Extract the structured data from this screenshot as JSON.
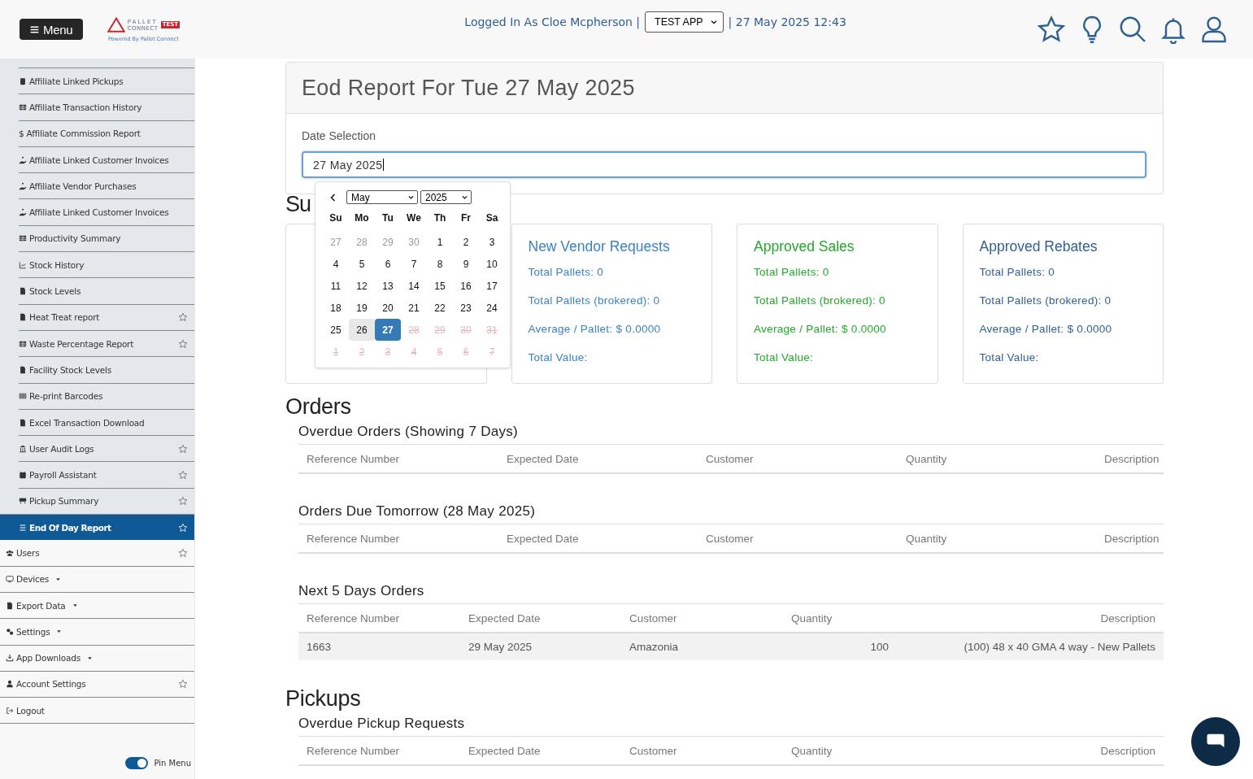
{
  "header": {
    "menu_button": "Menu",
    "logo": {
      "top": "PALLET",
      "middle": "CONNECT",
      "badge": "TEST",
      "caption": "Powered By Pallet Connect"
    },
    "logged_in": "Logged In As Cloe Mcpherson |",
    "app_select": "TEST APP",
    "datetime": "| 27 May 2025 12:43"
  },
  "sidebar": {
    "items": [
      {
        "label": "Affiliate Linked Pickups",
        "kind": "subitem",
        "selected": false,
        "favorite_button": false,
        "expandable": false
      },
      {
        "label": "Affiliate Transaction History",
        "kind": "subitem",
        "selected": false,
        "favorite_button": false,
        "expandable": false
      },
      {
        "label": "$ Affiliate Commission Report",
        "kind": "subitem",
        "selected": false,
        "favorite_button": false,
        "expandable": false
      },
      {
        "label": "Affiliate Linked Customer Invoices",
        "kind": "subitem",
        "selected": false,
        "favorite_button": false,
        "expandable": false
      },
      {
        "label": "Affiliate Vendor Purchases",
        "kind": "subitem",
        "selected": false,
        "favorite_button": false,
        "expandable": false
      },
      {
        "label": "Affiliate Linked Customer Invoices",
        "kind": "subitem",
        "selected": false,
        "favorite_button": false,
        "expandable": false
      },
      {
        "label": "Productivity Summary",
        "kind": "subitem",
        "selected": false,
        "favorite_button": false,
        "expandable": false
      },
      {
        "label": "Stock History",
        "kind": "subitem",
        "selected": false,
        "favorite_button": false,
        "expandable": false
      },
      {
        "label": "Stock Levels",
        "kind": "subitem",
        "selected": false,
        "favorite_button": false,
        "expandable": false
      },
      {
        "label": "Heat Treat report",
        "kind": "subitem",
        "selected": false,
        "favorite_button": true,
        "expandable": false
      },
      {
        "label": "Waste Percentage Report",
        "kind": "subitem",
        "selected": false,
        "favorite_button": true,
        "expandable": false
      },
      {
        "label": "Facility Stock Levels",
        "kind": "subitem",
        "selected": false,
        "favorite_button": false,
        "expandable": false
      },
      {
        "label": "Re-print Barcodes",
        "kind": "subitem",
        "selected": false,
        "favorite_button": false,
        "expandable": false
      },
      {
        "label": "Excel Transaction Download",
        "kind": "subitem",
        "selected": false,
        "favorite_button": false,
        "expandable": false
      },
      {
        "label": "User Audit Logs",
        "kind": "subitem",
        "selected": false,
        "favorite_button": true,
        "expandable": false
      },
      {
        "label": "Payroll Assistant",
        "kind": "subitem",
        "selected": false,
        "favorite_button": true,
        "expandable": false
      },
      {
        "label": "Pickup Summary",
        "kind": "subitem",
        "selected": false,
        "favorite_button": true,
        "expandable": false
      },
      {
        "label": "End Of Day Report",
        "kind": "subitem",
        "selected": true,
        "favorite_button": true,
        "expandable": false
      },
      {
        "label": "Users",
        "kind": "item",
        "selected": false,
        "favorite_button": true,
        "expandable": false
      },
      {
        "label": "Devices",
        "kind": "item",
        "selected": false,
        "favorite_button": false,
        "expandable": true
      },
      {
        "label": "Export Data",
        "kind": "item",
        "selected": false,
        "favorite_button": false,
        "expandable": true
      },
      {
        "label": "Settings",
        "kind": "item",
        "selected": false,
        "favorite_button": false,
        "expandable": true
      },
      {
        "label": "App Downloads",
        "kind": "item",
        "selected": false,
        "favorite_button": false,
        "expandable": true
      },
      {
        "label": "Account Settings",
        "kind": "item",
        "selected": false,
        "favorite_button": true,
        "expandable": false
      },
      {
        "label": "Logout",
        "kind": "item",
        "selected": false,
        "favorite_button": false,
        "expandable": false
      }
    ],
    "pin_menu": {
      "label": "Pin Menu",
      "on": true
    }
  },
  "report": {
    "title": "Eod Report For Tue 27 May 2025",
    "date_label": "Date Selection",
    "date_value": "27 May 2025"
  },
  "calendar": {
    "month": "May",
    "year": "2025",
    "weekdays": [
      "Su",
      "Mo",
      "Tu",
      "We",
      "Th",
      "Fr",
      "Sa"
    ],
    "days": [
      {
        "label": "27",
        "kind": "outside",
        "selected": false,
        "hovered": false
      },
      {
        "label": "28",
        "kind": "outside",
        "selected": false,
        "hovered": false
      },
      {
        "label": "29",
        "kind": "outside",
        "selected": false,
        "hovered": false
      },
      {
        "label": "30",
        "kind": "outside",
        "selected": false,
        "hovered": false
      },
      {
        "label": "1",
        "kind": "day",
        "selected": false,
        "hovered": false
      },
      {
        "label": "2",
        "kind": "day",
        "selected": false,
        "hovered": false
      },
      {
        "label": "3",
        "kind": "day",
        "selected": false,
        "hovered": false
      },
      {
        "label": "4",
        "kind": "day",
        "selected": false,
        "hovered": false
      },
      {
        "label": "5",
        "kind": "day",
        "selected": false,
        "hovered": false
      },
      {
        "label": "6",
        "kind": "day",
        "selected": false,
        "hovered": false
      },
      {
        "label": "7",
        "kind": "day",
        "selected": false,
        "hovered": false
      },
      {
        "label": "8",
        "kind": "day",
        "selected": false,
        "hovered": false
      },
      {
        "label": "9",
        "kind": "day",
        "selected": false,
        "hovered": false
      },
      {
        "label": "10",
        "kind": "day",
        "selected": false,
        "hovered": false
      },
      {
        "label": "11",
        "kind": "day",
        "selected": false,
        "hovered": false
      },
      {
        "label": "12",
        "kind": "day",
        "selected": false,
        "hovered": false
      },
      {
        "label": "13",
        "kind": "day",
        "selected": false,
        "hovered": false
      },
      {
        "label": "14",
        "kind": "day",
        "selected": false,
        "hovered": false
      },
      {
        "label": "15",
        "kind": "day",
        "selected": false,
        "hovered": false
      },
      {
        "label": "16",
        "kind": "day",
        "selected": false,
        "hovered": false
      },
      {
        "label": "17",
        "kind": "day",
        "selected": false,
        "hovered": false
      },
      {
        "label": "18",
        "kind": "day",
        "selected": false,
        "hovered": false
      },
      {
        "label": "19",
        "kind": "day",
        "selected": false,
        "hovered": false
      },
      {
        "label": "20",
        "kind": "day",
        "selected": false,
        "hovered": false
      },
      {
        "label": "21",
        "kind": "day",
        "selected": false,
        "hovered": false
      },
      {
        "label": "22",
        "kind": "day",
        "selected": false,
        "hovered": false
      },
      {
        "label": "23",
        "kind": "day",
        "selected": false,
        "hovered": false
      },
      {
        "label": "24",
        "kind": "day",
        "selected": false,
        "hovered": false
      },
      {
        "label": "25",
        "kind": "day",
        "selected": false,
        "hovered": false
      },
      {
        "label": "26",
        "kind": "day",
        "selected": false,
        "hovered": true
      },
      {
        "label": "27",
        "kind": "day",
        "selected": true,
        "hovered": false
      },
      {
        "label": "28",
        "kind": "disabled",
        "selected": false,
        "hovered": false
      },
      {
        "label": "29",
        "kind": "disabled",
        "selected": false,
        "hovered": false
      },
      {
        "label": "30",
        "kind": "disabled",
        "selected": false,
        "hovered": false
      },
      {
        "label": "31",
        "kind": "disabled",
        "selected": false,
        "hovered": false
      },
      {
        "label": "1",
        "kind": "disabled",
        "selected": false,
        "hovered": false
      },
      {
        "label": "2",
        "kind": "disabled",
        "selected": false,
        "hovered": false
      },
      {
        "label": "3",
        "kind": "disabled",
        "selected": false,
        "hovered": false
      },
      {
        "label": "4",
        "kind": "disabled",
        "selected": false,
        "hovered": false
      },
      {
        "label": "5",
        "kind": "disabled",
        "selected": false,
        "hovered": false
      },
      {
        "label": "6",
        "kind": "disabled",
        "selected": false,
        "hovered": false
      },
      {
        "label": "7",
        "kind": "disabled",
        "selected": false,
        "hovered": false
      }
    ]
  },
  "summary": {
    "heading": "Su",
    "cards": [
      {
        "kind": "covered"
      },
      {
        "kind": "stats",
        "title": "New Vendor Requests",
        "color": "#3b82c4",
        "lines": [
          "Total Pallets: 0",
          "Total Pallets (brokered): 0",
          "Average / Pallet: $ 0.0000",
          "Total Value:"
        ]
      },
      {
        "kind": "stats",
        "title": "Approved Sales",
        "color": "#22a82a",
        "lines": [
          "Total Pallets: 0",
          "Total Pallets (brokered): 0",
          "Average / Pallet: $ 0.0000",
          "Total Value:"
        ]
      },
      {
        "kind": "stats",
        "title": "Approved Rebates",
        "color": "#2f5f94",
        "lines": [
          "Total Pallets: 0",
          "Total Pallets (brokered): 0",
          "Average / Pallet: $ 0.0000",
          "Total Value:"
        ]
      }
    ]
  },
  "sections": [
    {
      "heading": "Orders",
      "tables": [
        {
          "title": "Overdue Orders (Showing 7 Days)",
          "kind": "even",
          "columns": [
            "Reference Number",
            "Expected Date",
            "Customer",
            "Quantity",
            "Description"
          ]
        },
        {
          "title": "Orders Due Tomorrow (28 May 2025)",
          "kind": "even",
          "columns": [
            "Reference Number",
            "Expected Date",
            "Customer",
            "Quantity",
            "Description"
          ]
        },
        {
          "title": "Next 5 Days Orders",
          "kind": "wide",
          "columns": [
            "Reference Number",
            "Expected Date",
            "Customer",
            "Quantity",
            "Description"
          ],
          "rows": [
            [
              "1663",
              "29 May 2025",
              "Amazonia",
              "100",
              "(100) 48 x 40 GMA 4 way - New Pallets"
            ]
          ]
        }
      ]
    },
    {
      "heading": "Pickups",
      "tables": [
        {
          "title": "Overdue Pickup Requests",
          "kind": "wide",
          "columns": [
            "Reference Number",
            "Expected Date",
            "Customer",
            "Quantity",
            "Description"
          ]
        }
      ]
    }
  ]
}
